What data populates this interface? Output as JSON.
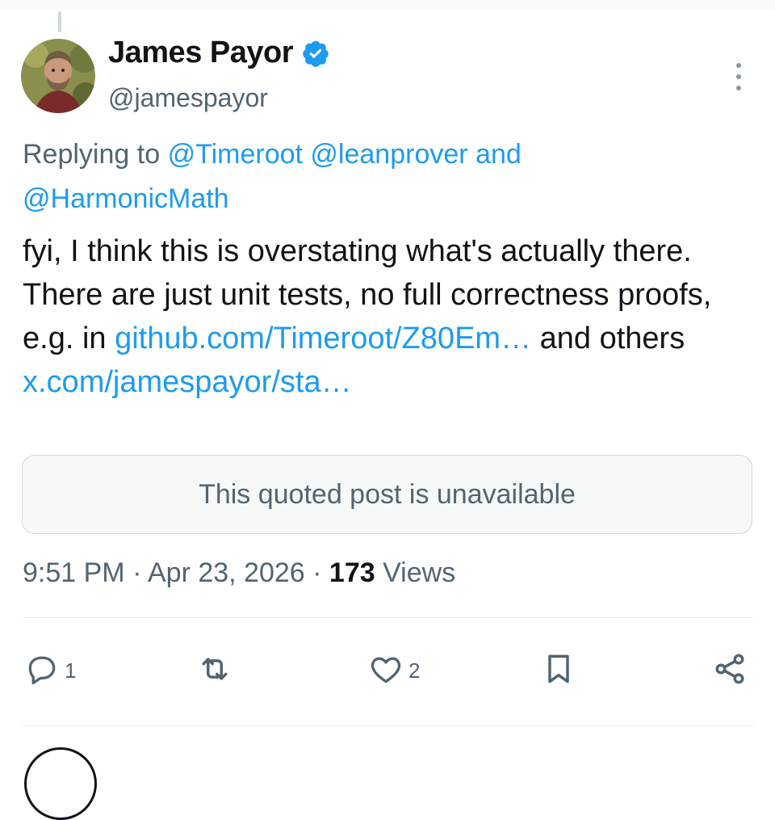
{
  "author": {
    "name": "James Payor",
    "handle": "@jamespayor",
    "verified": true
  },
  "reply": {
    "prefix": "Replying to",
    "mentions": [
      "@Timeroot",
      "@leanprover"
    ],
    "conjunction": "and",
    "last_mention": "@HarmonicMath"
  },
  "body": {
    "text1": "fyi, I think this is overstating what's actually there. There are just unit tests, no full correctness proofs, e.g. in ",
    "link1": "github.com/Timeroot/Z80Em…",
    "text2": " and others ",
    "link2": "x.com/jamespayor/sta…"
  },
  "quote": {
    "message": "This quoted post is unavailable"
  },
  "meta": {
    "time": "9:51 PM",
    "separator": "·",
    "date": "Apr 23, 2026",
    "views_count": "173",
    "views_label": "Views"
  },
  "actions": {
    "reply_count": "1",
    "like_count": "2"
  },
  "colors": {
    "accent": "#1d9bf0",
    "text": "#0f1419",
    "muted": "#536471"
  },
  "icons": [
    "verified-badge-icon",
    "more-icon",
    "reply-icon",
    "repost-icon",
    "like-icon",
    "bookmark-icon",
    "share-icon"
  ]
}
